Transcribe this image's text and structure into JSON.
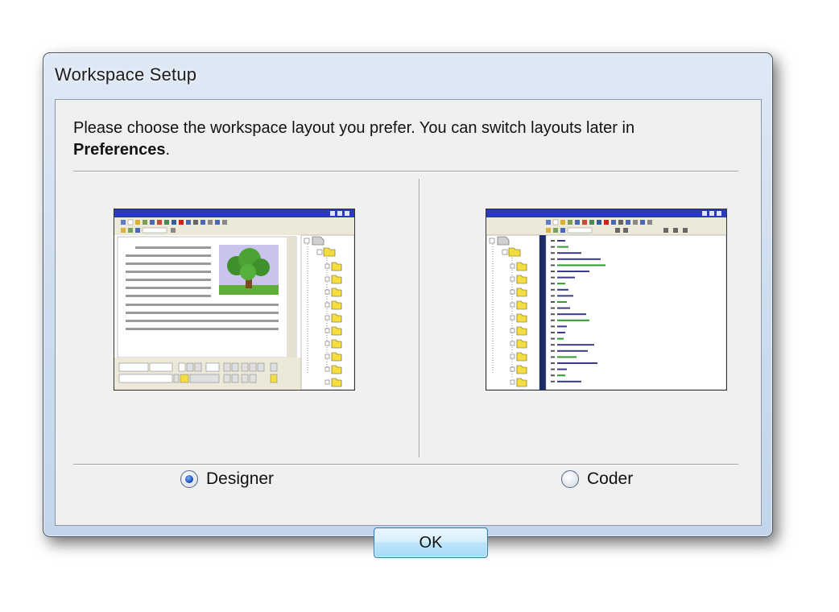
{
  "dialog": {
    "title": "Workspace Setup",
    "intro_text": "Please choose the workspace layout you prefer. You can switch layouts later in",
    "intro_bold": "Preferences",
    "intro_end": "."
  },
  "options": [
    {
      "label": "Designer",
      "selected": true
    },
    {
      "label": "Coder",
      "selected": false
    }
  ],
  "ok_label": "OK",
  "colors": {
    "preview_titlebar": "#2b3bb8",
    "folder": "#f4dd3f",
    "code_green": "#2f9b2f"
  }
}
